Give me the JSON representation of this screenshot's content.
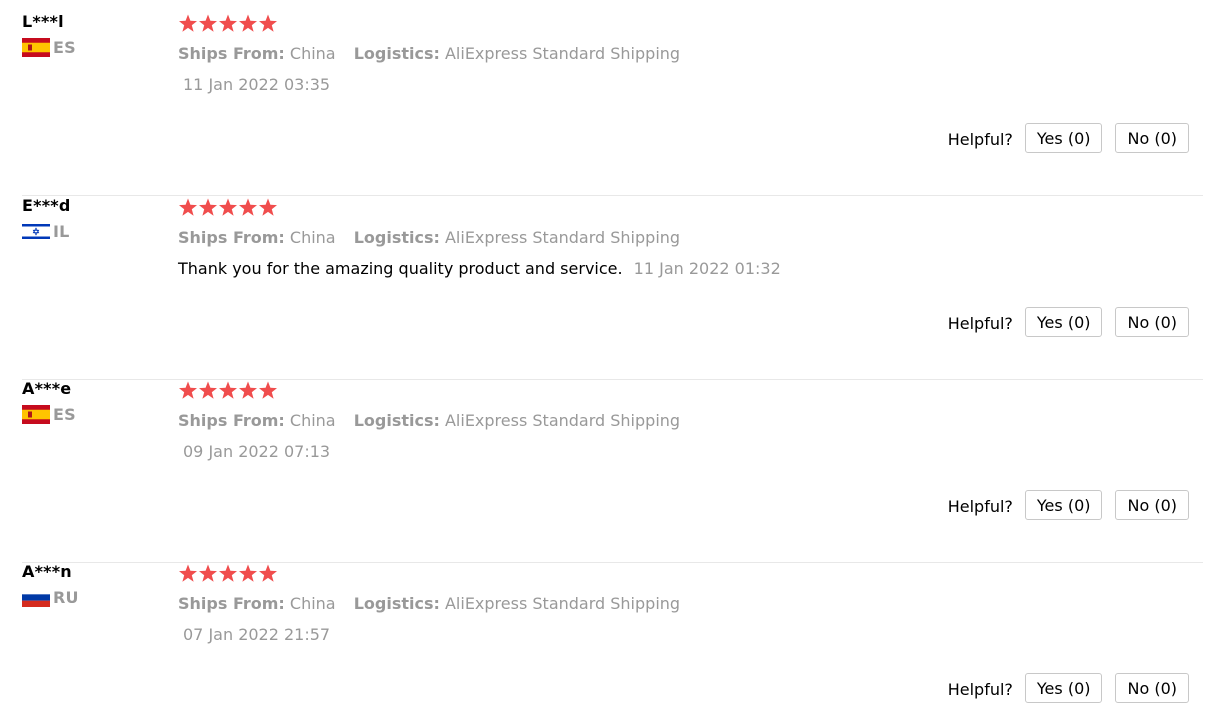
{
  "labels": {
    "ships_from": "Ships From:",
    "logistics": "Logistics:",
    "helpful": "Helpful?"
  },
  "colors": {
    "star": "#f04d4d",
    "muted": "#999999",
    "divider": "#e8e8e8"
  },
  "reviews": [
    {
      "user": "L***l",
      "country": "ES",
      "flag": "flag-spain-icon",
      "stars": 5,
      "ships_from": "China",
      "logistics": "AliExpress Standard Shipping",
      "text": "",
      "date": "11 Jan 2022 03:35",
      "yes": "Yes (0)",
      "no": "No (0)"
    },
    {
      "user": "E***d",
      "country": "IL",
      "flag": "flag-israel-icon",
      "stars": 5,
      "ships_from": "China",
      "logistics": "AliExpress Standard Shipping",
      "text": "Thank you for the amazing quality product and service.",
      "date": "11 Jan 2022 01:32",
      "yes": "Yes (0)",
      "no": "No (0)"
    },
    {
      "user": "A***e",
      "country": "ES",
      "flag": "flag-spain-icon",
      "stars": 5,
      "ships_from": "China",
      "logistics": "AliExpress Standard Shipping",
      "text": "",
      "date": "09 Jan 2022 07:13",
      "yes": "Yes (0)",
      "no": "No (0)"
    },
    {
      "user": "A***n",
      "country": "RU",
      "flag": "flag-russia-icon",
      "stars": 5,
      "ships_from": "China",
      "logistics": "AliExpress Standard Shipping",
      "text": "",
      "date": "07 Jan 2022 21:57",
      "yes": "Yes (0)",
      "no": "No (0)"
    }
  ]
}
